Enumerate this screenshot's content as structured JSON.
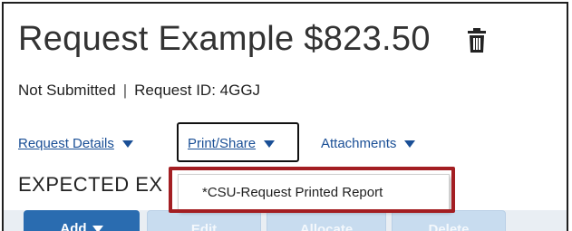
{
  "header": {
    "title": "Request Example $823.50",
    "status": "Not Submitted",
    "separator": "|",
    "request_id": "Request ID: 4GGJ"
  },
  "tabs": [
    {
      "label": "Request Details",
      "icon": "chevron-down-icon"
    },
    {
      "label": "Print/Share",
      "icon": "chevron-down-icon",
      "active_outline": true
    },
    {
      "label": "Attachments",
      "icon": "chevron-down-icon"
    }
  ],
  "section": {
    "title": "EXPECTED EX"
  },
  "dropdown": {
    "items": [
      {
        "label": "*CSU-Request Printed Report"
      }
    ],
    "highlight_color": "#a31e22"
  },
  "toolbar": {
    "add_label": "Add",
    "edit_label": "Edit",
    "allocate_label": "Allocate",
    "delete_label": "Delete"
  },
  "colors": {
    "link": "#1a4f96",
    "primary_button": "#2a6cb0",
    "disabled_button": "#c8dcef"
  }
}
